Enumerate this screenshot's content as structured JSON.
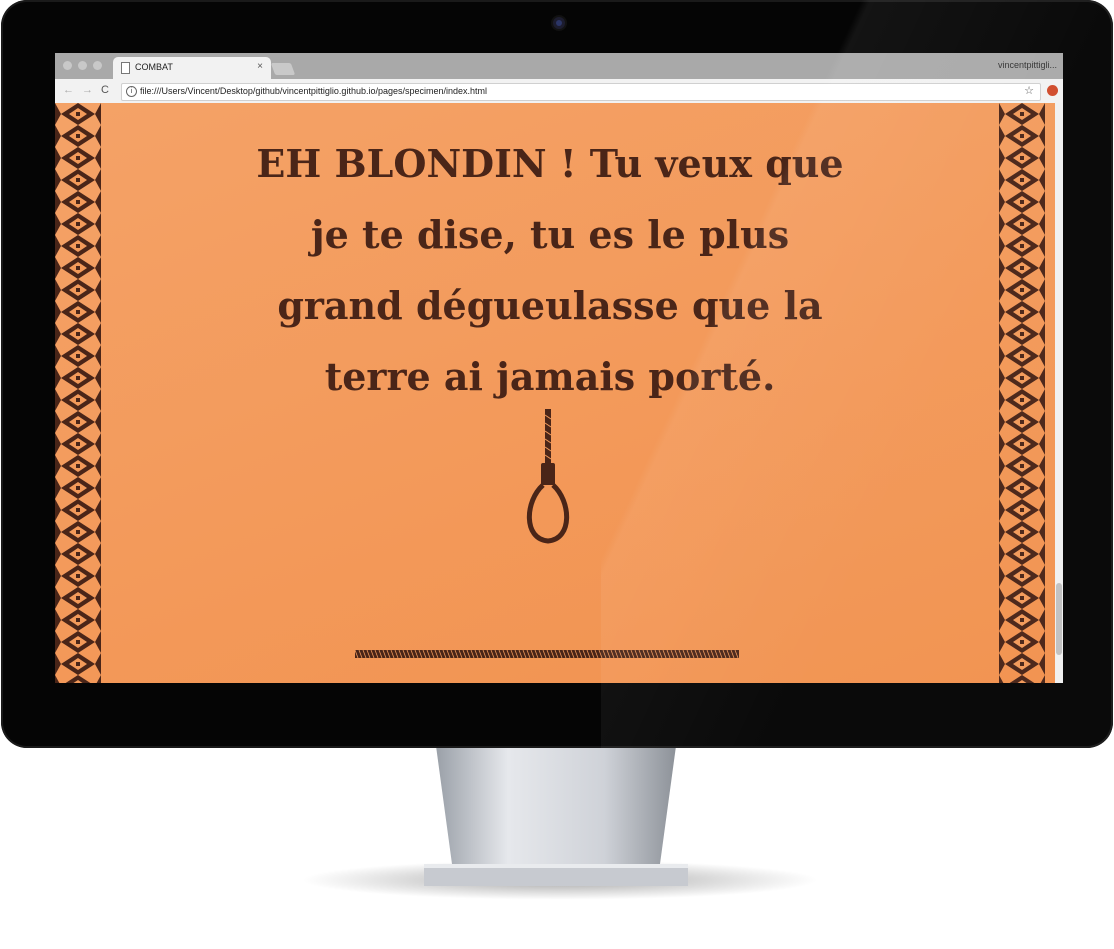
{
  "browser": {
    "tab_title": "COMBAT",
    "tab_close": "×",
    "profile_label": "vincentpittigli...",
    "url": "file:///Users/Vincent/Desktop/github/vincentpittiglio.github.io/pages/specimen/index.html",
    "back_icon": "←",
    "forward_icon": "→",
    "reload_icon": "C",
    "info_icon": "i",
    "star_icon": "☆"
  },
  "page": {
    "quote": "EH BLONDIN ! Tu veux que je te dise, tu es le plus grand dégueulasse que la terre ai jamais porté.",
    "background_color": "#f39a5a",
    "ink_color": "#4a2518"
  },
  "icons": [
    "file-icon",
    "info-icon",
    "star-icon",
    "extension-icon",
    "noose-icon",
    "rope-divider"
  ]
}
